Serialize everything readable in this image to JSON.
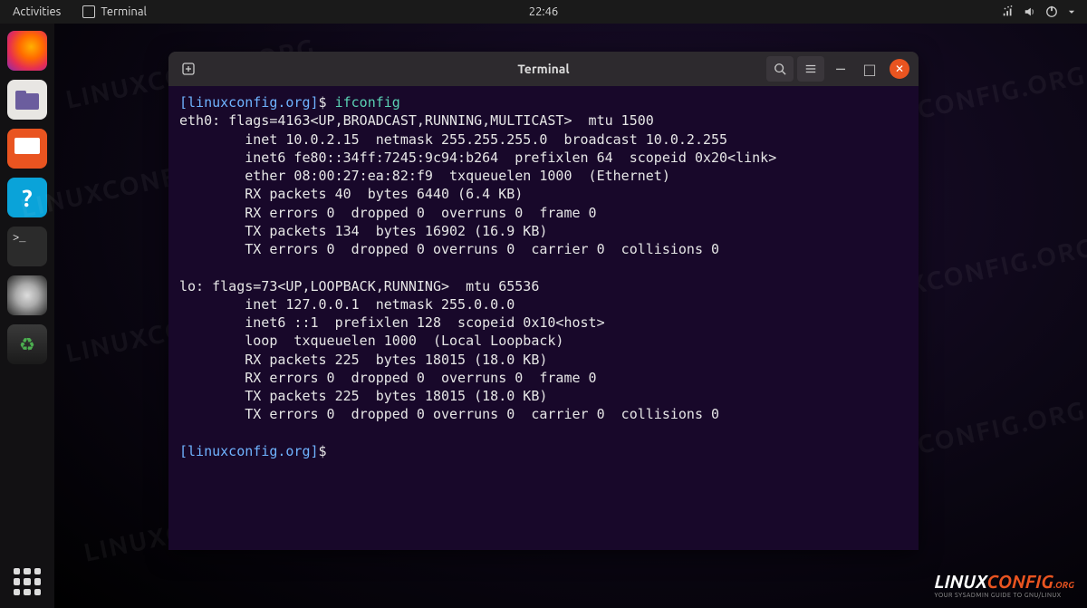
{
  "topbar": {
    "activities": "Activities",
    "app_name": "Terminal",
    "clock": "22:46"
  },
  "dock": {
    "items": [
      "firefox",
      "files",
      "software",
      "help",
      "terminal",
      "disk",
      "trash"
    ]
  },
  "terminal_window": {
    "title": "Terminal",
    "buttons": {
      "search": "search",
      "menu": "menu",
      "min": "minimize",
      "max": "maximize",
      "close": "close"
    }
  },
  "terminal": {
    "prompt_user": "[linuxconfig.org]",
    "prompt_symbol": "$",
    "command": "ifconfig",
    "output_lines": [
      "eth0: flags=4163<UP,BROADCAST,RUNNING,MULTICAST>  mtu 1500",
      "        inet 10.0.2.15  netmask 255.255.255.0  broadcast 10.0.2.255",
      "        inet6 fe80::34ff:7245:9c94:b264  prefixlen 64  scopeid 0x20<link>",
      "        ether 08:00:27:ea:82:f9  txqueuelen 1000  (Ethernet)",
      "        RX packets 40  bytes 6440 (6.4 KB)",
      "        RX errors 0  dropped 0  overruns 0  frame 0",
      "        TX packets 134  bytes 16902 (16.9 KB)",
      "        TX errors 0  dropped 0 overruns 0  carrier 0  collisions 0",
      "",
      "lo: flags=73<UP,LOOPBACK,RUNNING>  mtu 65536",
      "        inet 127.0.0.1  netmask 255.0.0.0",
      "        inet6 ::1  prefixlen 128  scopeid 0x10<host>",
      "        loop  txqueuelen 1000  (Local Loopback)",
      "        RX packets 225  bytes 18015 (18.0 KB)",
      "        RX errors 0  dropped 0  overruns 0  frame 0",
      "        TX packets 225  bytes 18015 (18.0 KB)",
      "        TX errors 0  dropped 0 overruns 0  carrier 0  collisions 0"
    ]
  },
  "watermark": "LINUXCONFIG.ORG",
  "brand": {
    "text_pre": "LINUX",
    "text_post": "CONFIG",
    "tagline": "YOUR SYSADMIN GUIDE TO GNU/LINUX"
  }
}
